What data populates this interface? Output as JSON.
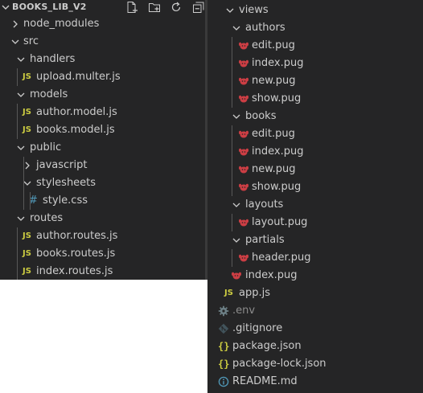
{
  "explorer": {
    "title": "BOOKS_LIB_V2",
    "actions": [
      "new-file-icon",
      "new-folder-icon",
      "refresh-icon",
      "collapse-all-icon"
    ]
  },
  "left_tree": [
    {
      "name": "node_modules",
      "type": "folder",
      "expanded": false
    },
    {
      "name": "src",
      "type": "folder",
      "expanded": true
    },
    {
      "name": "handlers",
      "type": "folder",
      "expanded": true
    },
    {
      "name": "upload.multer.js",
      "type": "js"
    },
    {
      "name": "models",
      "type": "folder",
      "expanded": true
    },
    {
      "name": "author.model.js",
      "type": "js"
    },
    {
      "name": "books.model.js",
      "type": "js"
    },
    {
      "name": "public",
      "type": "folder",
      "expanded": true
    },
    {
      "name": "javascript",
      "type": "folder",
      "expanded": false
    },
    {
      "name": "stylesheets",
      "type": "folder",
      "expanded": true
    },
    {
      "name": "style.css",
      "type": "css"
    },
    {
      "name": "routes",
      "type": "folder",
      "expanded": true
    },
    {
      "name": "author.routes.js",
      "type": "js"
    },
    {
      "name": "books.routes.js",
      "type": "js"
    },
    {
      "name": "index.routes.js",
      "type": "js"
    }
  ],
  "right_tree": [
    {
      "name": "views",
      "type": "folder",
      "expanded": true
    },
    {
      "name": "authors",
      "type": "folder",
      "expanded": true
    },
    {
      "name": "edit.pug",
      "type": "pug"
    },
    {
      "name": "index.pug",
      "type": "pug"
    },
    {
      "name": "new.pug",
      "type": "pug"
    },
    {
      "name": "show.pug",
      "type": "pug"
    },
    {
      "name": "books",
      "type": "folder",
      "expanded": true
    },
    {
      "name": "edit.pug",
      "type": "pug"
    },
    {
      "name": "index.pug",
      "type": "pug"
    },
    {
      "name": "new.pug",
      "type": "pug"
    },
    {
      "name": "show.pug",
      "type": "pug"
    },
    {
      "name": "layouts",
      "type": "folder",
      "expanded": true
    },
    {
      "name": "layout.pug",
      "type": "pug"
    },
    {
      "name": "partials",
      "type": "folder",
      "expanded": true
    },
    {
      "name": "header.pug",
      "type": "pug"
    },
    {
      "name": "index.pug",
      "type": "pug"
    },
    {
      "name": "app.js",
      "type": "js"
    },
    {
      "name": ".env",
      "type": "env"
    },
    {
      "name": ".gitignore",
      "type": "git"
    },
    {
      "name": "package.json",
      "type": "json"
    },
    {
      "name": "package-lock.json",
      "type": "json"
    },
    {
      "name": "README.md",
      "type": "md"
    }
  ],
  "icons": {
    "js_glyph": "JS",
    "css_glyph": "#",
    "json_glyph": "{}"
  },
  "colors": {
    "background": "#252526",
    "text": "#cccccc",
    "js": "#cbcb41",
    "css": "#519aba",
    "pug": "#cc3e44",
    "guide": "#585858"
  }
}
